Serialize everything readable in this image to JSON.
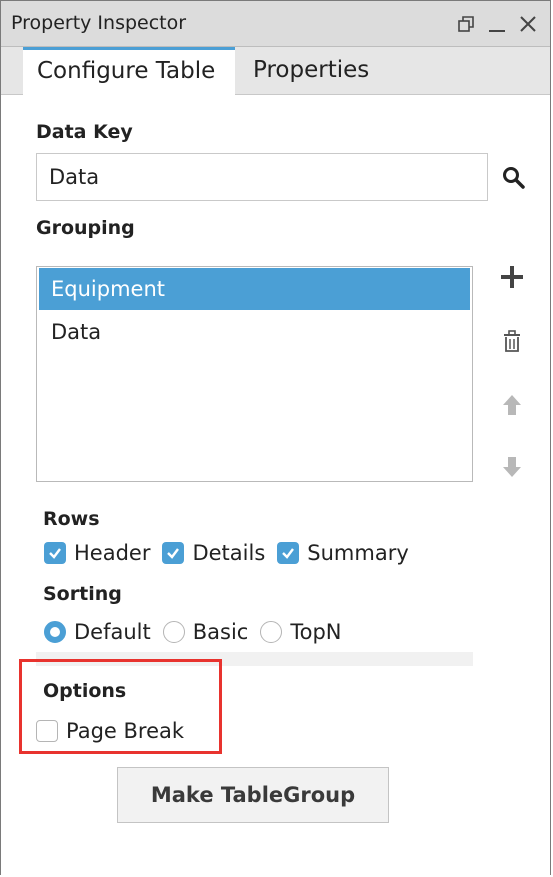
{
  "window": {
    "title": "Property Inspector"
  },
  "tabs": [
    {
      "label": "Configure Table",
      "active": true
    },
    {
      "label": "Properties",
      "active": false
    }
  ],
  "data_key": {
    "label": "Data Key",
    "value": "Data"
  },
  "grouping": {
    "label": "Grouping",
    "items": [
      {
        "label": "Equipment",
        "selected": true
      },
      {
        "label": "Data",
        "selected": false
      }
    ]
  },
  "rows": {
    "label": "Rows",
    "options": [
      {
        "label": "Header",
        "checked": true
      },
      {
        "label": "Details",
        "checked": true
      },
      {
        "label": "Summary",
        "checked": true
      }
    ]
  },
  "sorting": {
    "label": "Sorting",
    "options": [
      {
        "label": "Default",
        "selected": true
      },
      {
        "label": "Basic",
        "selected": false
      },
      {
        "label": "TopN",
        "selected": false
      }
    ]
  },
  "options": {
    "label": "Options",
    "page_break": {
      "label": "Page Break",
      "checked": false
    }
  },
  "make_button": {
    "label": "Make TableGroup"
  },
  "colors": {
    "accent": "#4b9fd5",
    "highlight": "#e8332e"
  }
}
